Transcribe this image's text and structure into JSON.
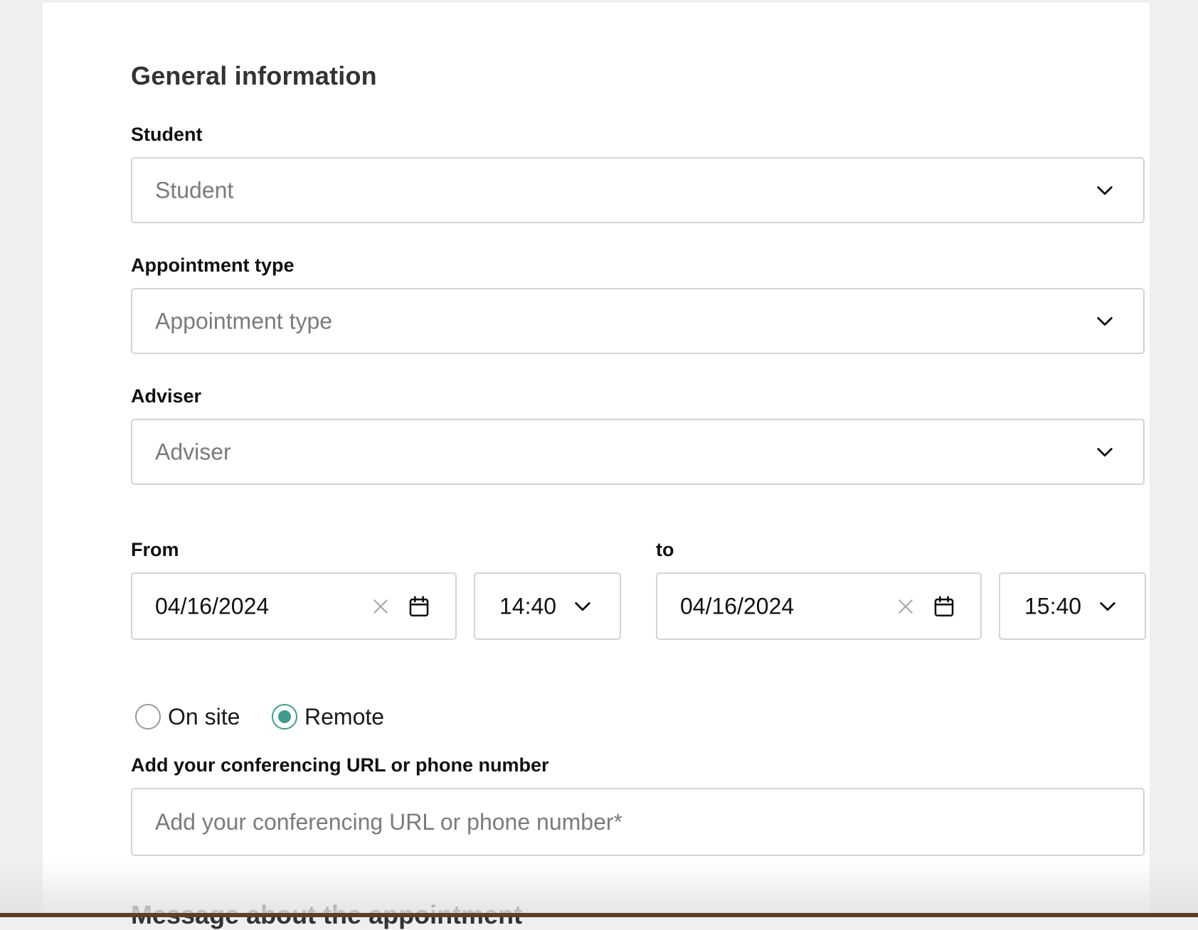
{
  "form": {
    "section_title": "General information",
    "student": {
      "label": "Student",
      "placeholder": "Student"
    },
    "appointment_type": {
      "label": "Appointment type",
      "placeholder": "Appointment type"
    },
    "adviser": {
      "label": "Adviser",
      "placeholder": "Adviser"
    },
    "from": {
      "label": "From",
      "date": "04/16/2024",
      "time": "14:40"
    },
    "to": {
      "label": "to",
      "date": "04/16/2024",
      "time": "15:40"
    },
    "location": {
      "options": [
        "On site",
        "Remote"
      ],
      "selected": "Remote"
    },
    "conferencing": {
      "label": "Add your conferencing URL or phone number",
      "placeholder": "Add your conferencing URL or phone number*"
    },
    "next_section_title": "Message about the appointment"
  },
  "colors": {
    "accent": "#3f9c8f",
    "border": "#d4d4d4",
    "placeholder": "#7b7b7b"
  }
}
